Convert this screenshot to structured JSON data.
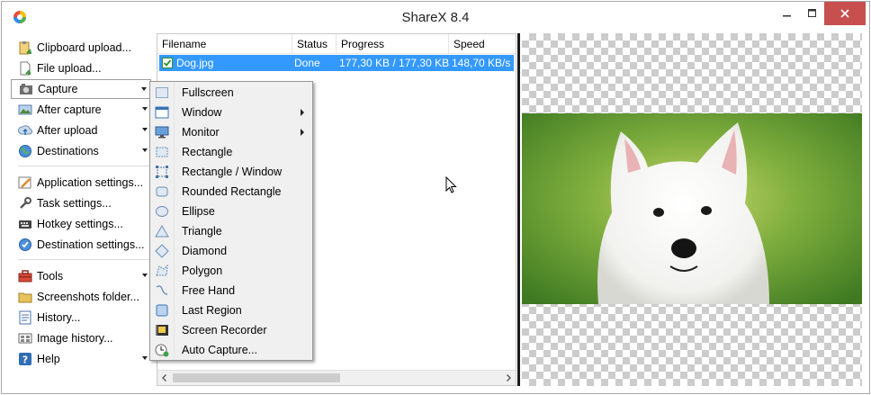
{
  "window": {
    "title": "ShareX 8.4"
  },
  "sidebar": {
    "items": [
      {
        "label": "Clipboard upload...",
        "icon": "clipboard-upload-icon"
      },
      {
        "label": "File upload...",
        "icon": "file-upload-icon"
      },
      {
        "label": "Capture",
        "icon": "capture-icon",
        "has_menu": true,
        "active": true
      },
      {
        "label": "After capture",
        "icon": "after-capture-icon",
        "has_menu": true
      },
      {
        "label": "After upload",
        "icon": "after-upload-icon",
        "has_menu": true
      },
      {
        "label": "Destinations",
        "icon": "destinations-icon",
        "has_menu": true
      },
      {
        "label": "Application settings...",
        "icon": "application-settings-icon"
      },
      {
        "label": "Task settings...",
        "icon": "task-settings-icon"
      },
      {
        "label": "Hotkey settings...",
        "icon": "hotkey-settings-icon"
      },
      {
        "label": "Destination settings...",
        "icon": "destination-settings-icon"
      },
      {
        "label": "Tools",
        "icon": "tools-icon",
        "has_menu": true
      },
      {
        "label": "Screenshots folder...",
        "icon": "screenshots-folder-icon"
      },
      {
        "label": "History...",
        "icon": "history-icon"
      },
      {
        "label": "Image history...",
        "icon": "image-history-icon"
      },
      {
        "label": "Help",
        "icon": "help-icon",
        "has_menu": true
      }
    ]
  },
  "list": {
    "columns": [
      "Filename",
      "Status",
      "Progress",
      "Speed"
    ],
    "rows": [
      {
        "filename": "Dog.jpg",
        "status": "Done",
        "progress": "177,30 KB / 177,30 KB",
        "speed": "148,70 KB/s"
      }
    ]
  },
  "capture_menu": {
    "items": [
      {
        "label": "Fullscreen",
        "icon": "fullscreen-icon"
      },
      {
        "label": "Window",
        "icon": "window-icon",
        "submenu": true
      },
      {
        "label": "Monitor",
        "icon": "monitor-icon",
        "submenu": true
      },
      {
        "label": "Rectangle",
        "icon": "rectangle-icon"
      },
      {
        "label": "Rectangle / Window",
        "icon": "rectangle-window-icon"
      },
      {
        "label": "Rounded Rectangle",
        "icon": "rounded-rectangle-icon"
      },
      {
        "label": "Ellipse",
        "icon": "ellipse-icon"
      },
      {
        "label": "Triangle",
        "icon": "triangle-icon"
      },
      {
        "label": "Diamond",
        "icon": "diamond-icon"
      },
      {
        "label": "Polygon",
        "icon": "polygon-icon"
      },
      {
        "label": "Free Hand",
        "icon": "free-hand-icon"
      },
      {
        "label": "Last Region",
        "icon": "last-region-icon"
      },
      {
        "label": "Screen Recorder",
        "icon": "screen-recorder-icon"
      },
      {
        "label": "Auto Capture...",
        "icon": "auto-capture-icon"
      }
    ]
  },
  "colors": {
    "selection": "#3399ff",
    "close_button": "#c7504f",
    "preview_checker": "#cccccc",
    "dog_background": "#5f9530"
  }
}
